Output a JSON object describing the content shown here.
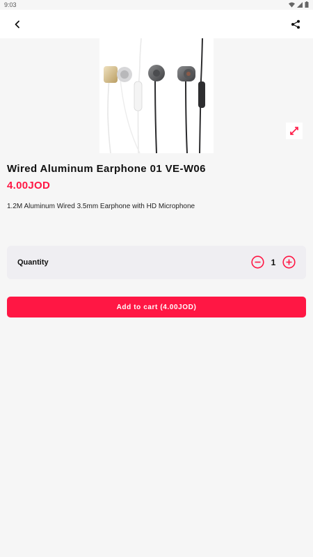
{
  "status_bar": {
    "time": "9:03",
    "icons": [
      "wifi-icon",
      "signal-icon",
      "battery-icon"
    ]
  },
  "app_bar": {
    "back_icon": "back-arrow-icon",
    "share_icon": "share-icon"
  },
  "product": {
    "image": "wired-earphones-image",
    "title": "Wired Aluminum Earphone 01 VE-W06",
    "price": "4.00JOD",
    "description": "1.2M Aluminum Wired 3.5mm Earphone with HD Microphone"
  },
  "quantity": {
    "label": "Quantity",
    "value": "1"
  },
  "cart": {
    "button_label": "Add to cart (4.00JOD)"
  },
  "colors": {
    "accent": "#ff1744",
    "background": "#f6f6f6",
    "card": "#efeef2"
  }
}
